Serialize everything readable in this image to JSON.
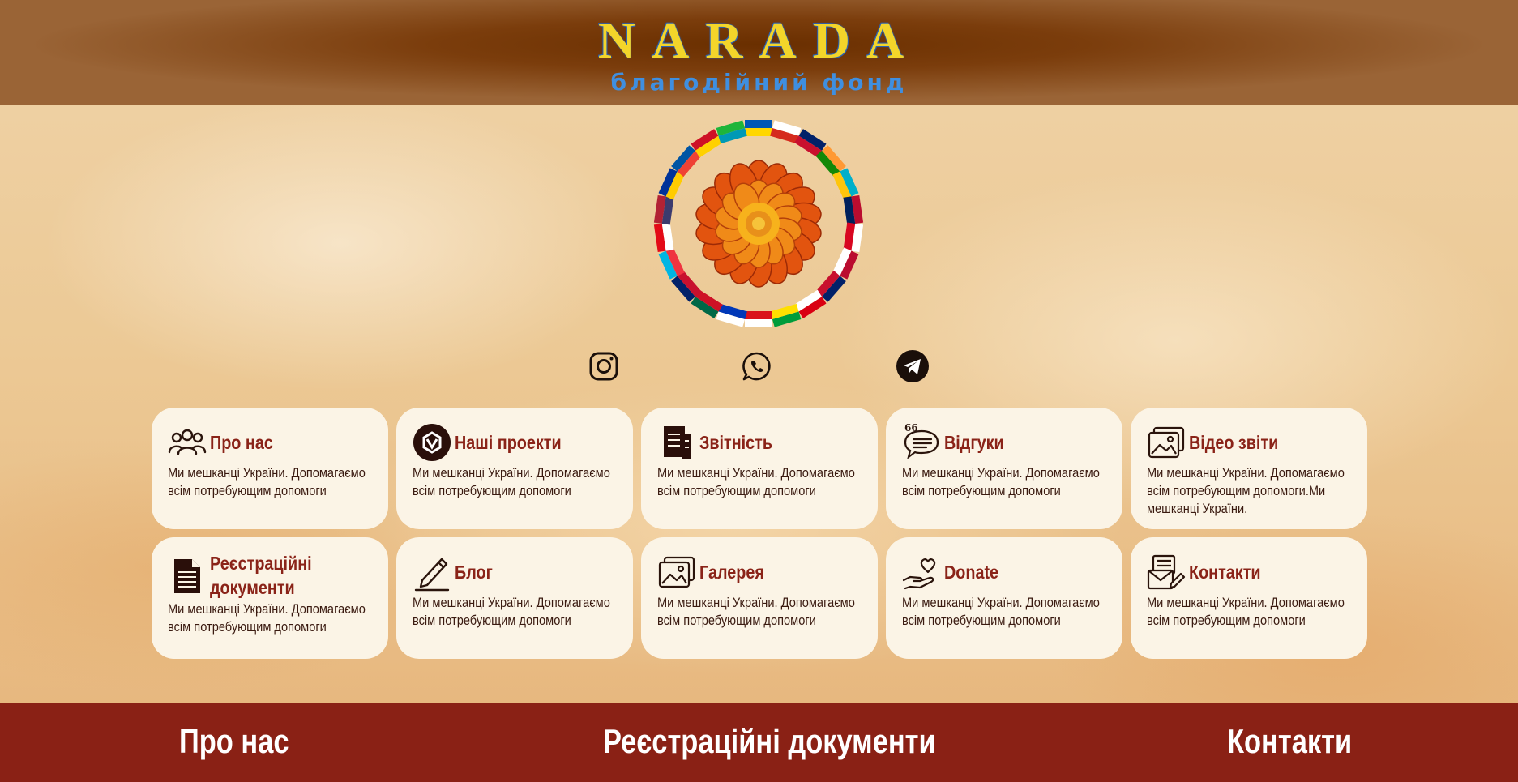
{
  "header": {
    "brand": "NARADA",
    "tagline": "благодійний фонд"
  },
  "logo": {
    "icon": "marigold-flag-wreath-logo"
  },
  "social": [
    {
      "icon": "instagram-icon"
    },
    {
      "icon": "whatsapp-icon"
    },
    {
      "icon": "telegram-icon"
    }
  ],
  "cards": [
    {
      "icon": "people-icon",
      "title": "Про нас",
      "text": "Ми мешканці України. Допомагаємо всім потребующим допомоги"
    },
    {
      "icon": "projects-icon",
      "title": "Наші проекти",
      "text": "Ми мешканці України. Допомагаємо всім потребующим допомоги"
    },
    {
      "icon": "report-icon",
      "title": "Звітність",
      "text": "Ми мешканці України. Допомагаємо всім потребующим допомоги"
    },
    {
      "icon": "reviews-icon",
      "title": "Відгуки",
      "text": "Ми мешканці України. Допомагаємо всім потребующим допомоги"
    },
    {
      "icon": "video-report-icon",
      "title": "Відео звіти",
      "text": "Ми мешканці України. Допомагаємо всім потребующим допомоги.Ми мешканці України."
    },
    {
      "icon": "document-icon",
      "title": "Реєстраційні документи",
      "text": "Ми мешканці України. Допомагаємо всім потребующим допомоги"
    },
    {
      "icon": "pen-icon",
      "title": "Блог",
      "text": "Ми мешканці України. Допомагаємо всім потребующим допомоги"
    },
    {
      "icon": "gallery-icon",
      "title": "Галерея",
      "text": "Ми мешканці України. Допомагаємо всім потребующим допомоги"
    },
    {
      "icon": "donate-hand-heart-icon",
      "title": "Donate",
      "text": "Ми мешканці України. Допомагаємо всім потребующим допомоги"
    },
    {
      "icon": "contacts-icon",
      "title": "Контакти",
      "text": "Ми мешканці України. Допомагаємо всім потребующим допомоги"
    }
  ],
  "footer": {
    "links": [
      "Про нас",
      "Реєстраційні документи",
      "Контакти"
    ]
  },
  "colors": {
    "header_brown": "#7b3d0c",
    "brand_yellow": "#f3d52a",
    "tagline_blue": "#3f8fe0",
    "card_bg": "#fbf4e6",
    "card_title": "#8a2318",
    "footer_red": "#8a2115"
  }
}
